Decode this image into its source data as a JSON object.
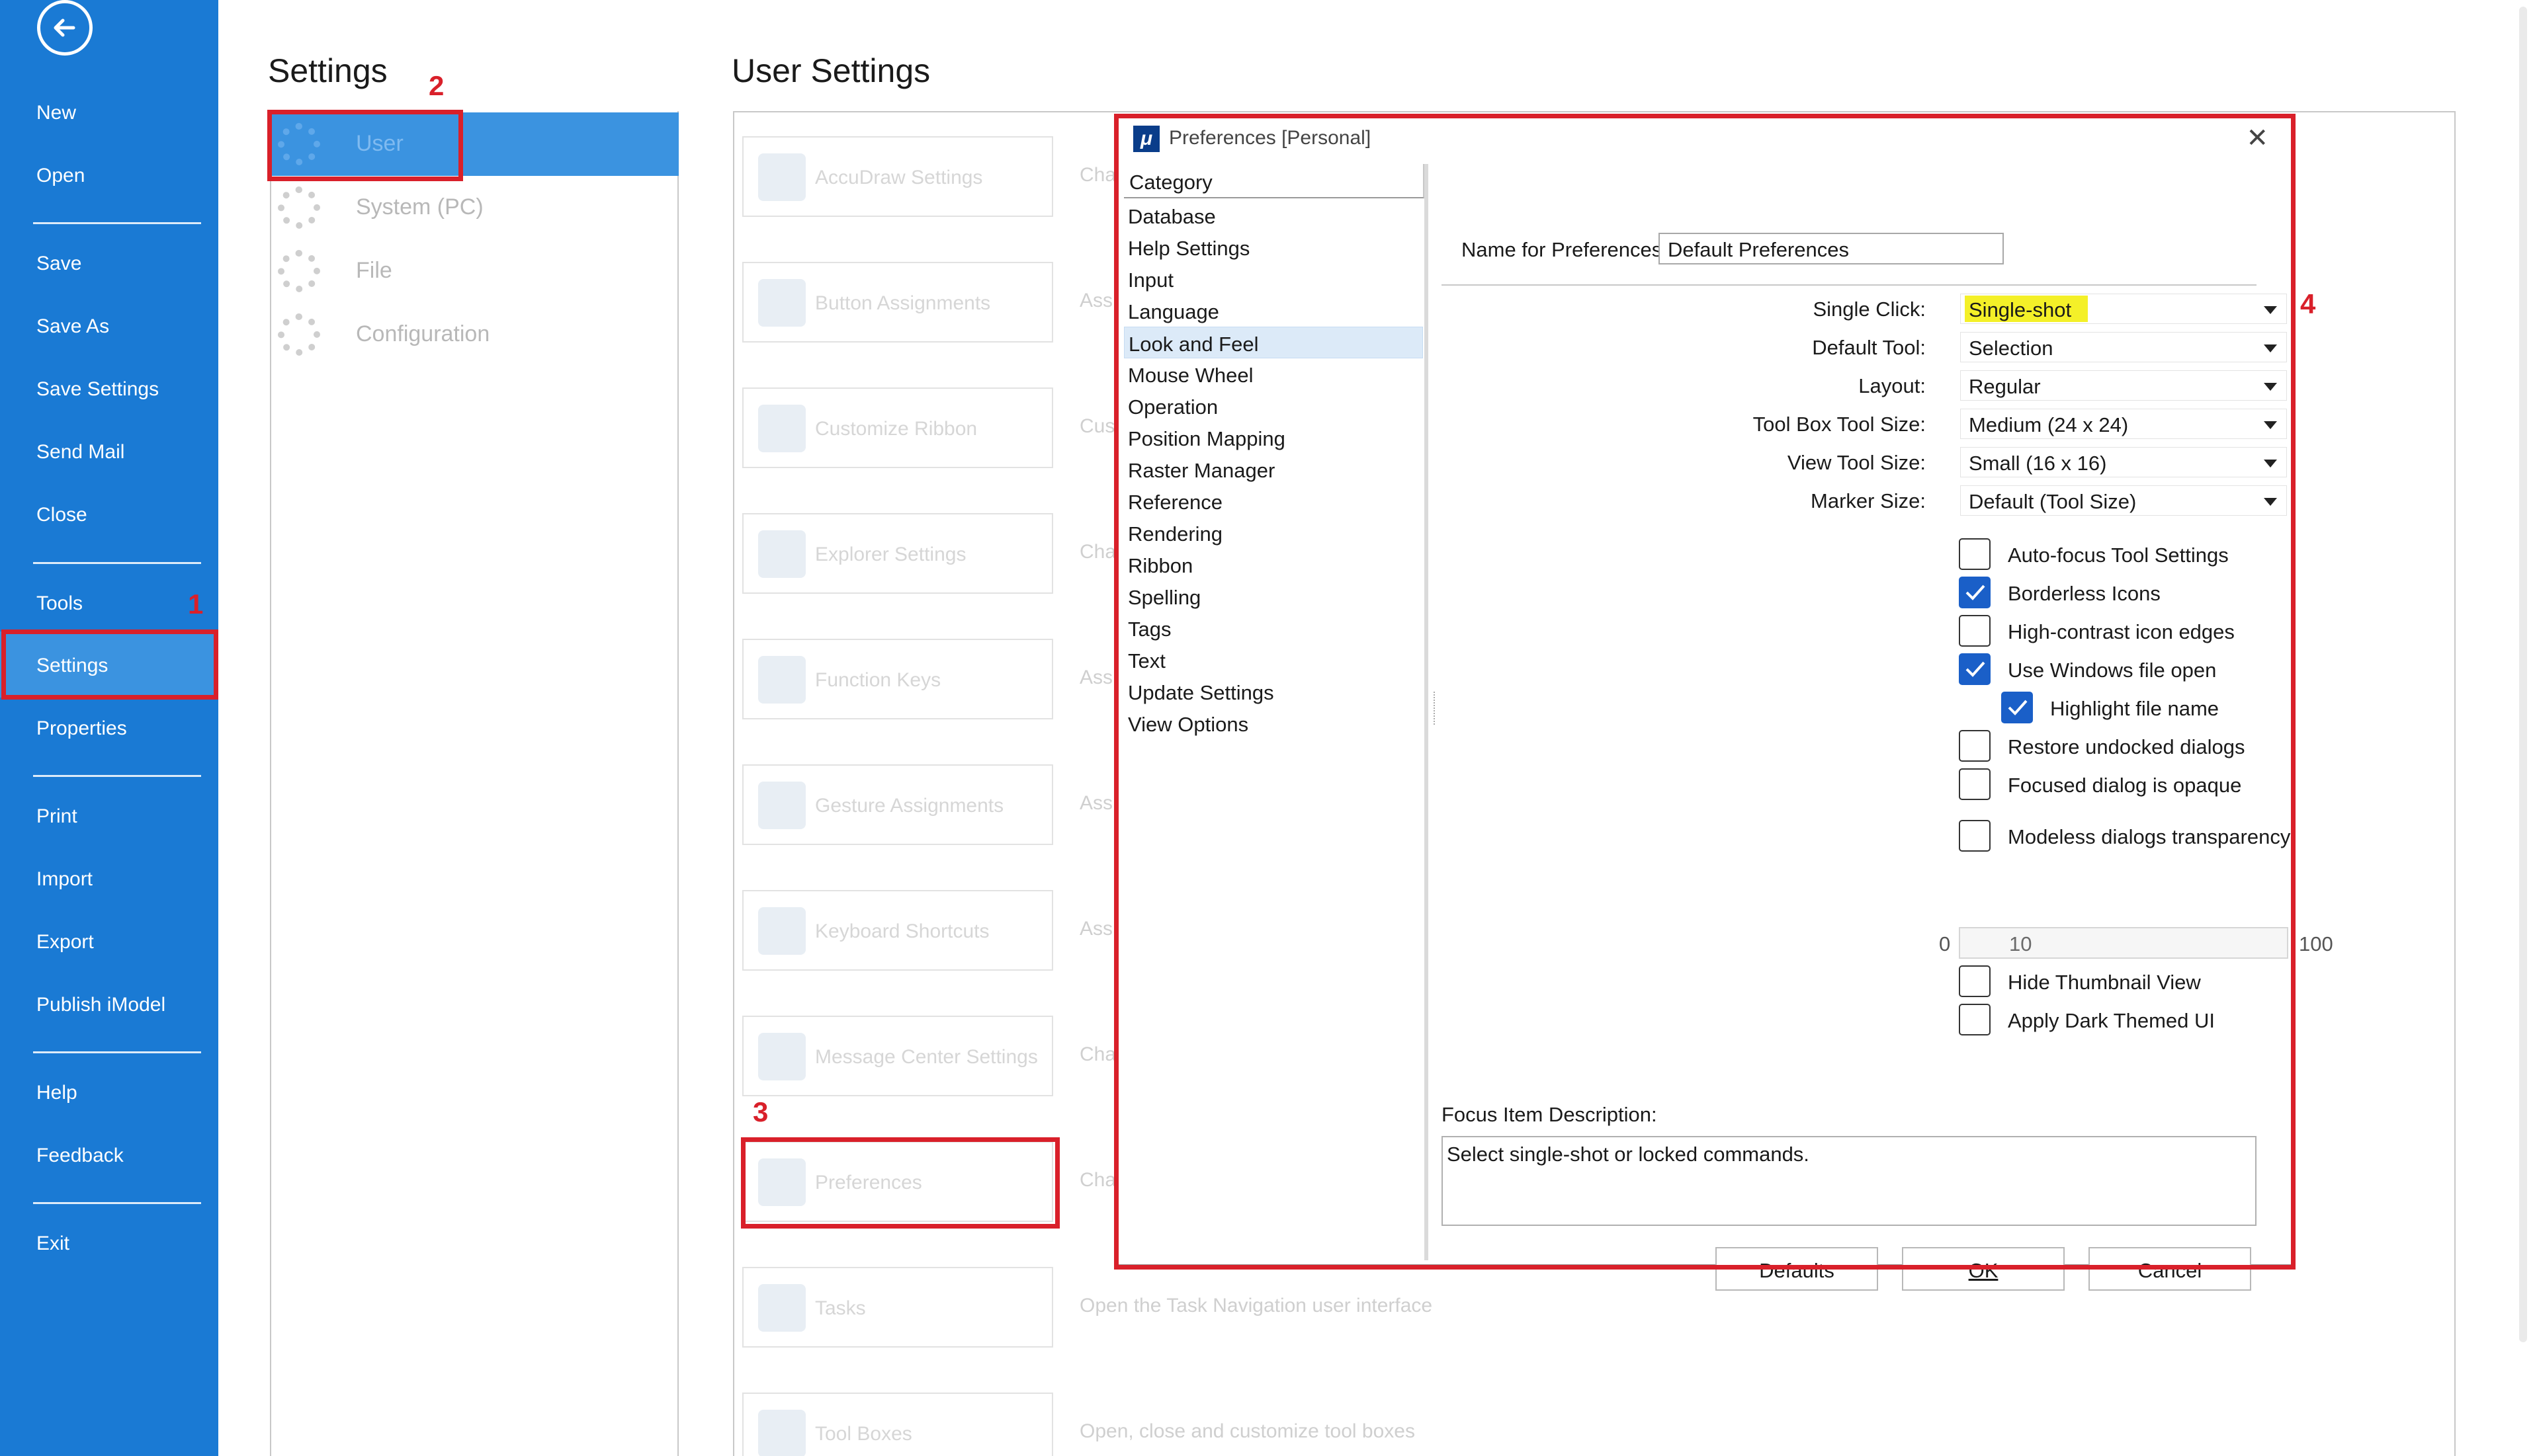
{
  "nav": {
    "items": [
      "New",
      "Open",
      "Save",
      "Save As",
      "Save Settings",
      "Send Mail",
      "Close",
      "Tools",
      "Settings",
      "Properties",
      "Print",
      "Import",
      "Export",
      "Publish iModel",
      "Help",
      "Feedback",
      "Exit"
    ],
    "active": "Settings"
  },
  "settings": {
    "title": "Settings",
    "items": [
      "User",
      "System (PC)",
      "File",
      "Configuration"
    ],
    "selected": "User"
  },
  "user_settings": {
    "title": "User Settings",
    "tiles": [
      {
        "label": "AccuDraw Settings",
        "desc": "Cha"
      },
      {
        "label": "Button Assignments",
        "desc": "Ass"
      },
      {
        "label": "Customize Ribbon",
        "desc": "Cus"
      },
      {
        "label": "Explorer Settings",
        "desc": "Cha"
      },
      {
        "label": "Function Keys",
        "desc": "Ass"
      },
      {
        "label": "Gesture Assignments",
        "desc": "Ass"
      },
      {
        "label": "Keyboard Shortcuts",
        "desc": "Ass"
      },
      {
        "label": "Message Center Settings",
        "desc": "Cha"
      },
      {
        "label": "Preferences",
        "desc": "Cha"
      },
      {
        "label": "Tasks",
        "desc": "Open the Task Navigation user interface"
      },
      {
        "label": "Tool Boxes",
        "desc": "Open, close and customize tool boxes"
      }
    ]
  },
  "annotations": [
    "1",
    "2",
    "3",
    "4"
  ],
  "dialog": {
    "title": "Preferences [Personal]",
    "close": "✕",
    "category_header": "Category",
    "categories": [
      "Database",
      "Help Settings",
      "Input",
      "Language",
      "Look and Feel",
      "Mouse Wheel",
      "Operation",
      "Position Mapping",
      "Raster Manager",
      "Reference",
      "Rendering",
      "Ribbon",
      "Spelling",
      "Tags",
      "Text",
      "Update Settings",
      "View Options"
    ],
    "selected_category": "Look and Feel",
    "name_label": "Name for Preferences:",
    "name_value": "Default Preferences",
    "fields": [
      {
        "label": "Single Click:",
        "value": "Single-shot"
      },
      {
        "label": "Default Tool:",
        "value": "Selection"
      },
      {
        "label": "Layout:",
        "value": "Regular"
      },
      {
        "label": "Tool Box Tool Size:",
        "value": "Medium (24 x 24)"
      },
      {
        "label": "View Tool Size:",
        "value": "Small (16 x 16)"
      },
      {
        "label": "Marker Size:",
        "value": "Default (Tool Size)"
      }
    ],
    "checkboxes": [
      {
        "label": "Auto-focus Tool Settings",
        "checked": false
      },
      {
        "label": "Borderless Icons",
        "checked": true
      },
      {
        "label": "High-contrast icon edges",
        "checked": false
      },
      {
        "label": "Use Windows file open",
        "checked": true
      },
      {
        "label": "Highlight file name",
        "checked": true
      },
      {
        "label": "Restore undocked dialogs",
        "checked": false
      },
      {
        "label": "Focused dialog is opaque",
        "checked": false
      },
      {
        "label": "Modeless dialogs transparency",
        "checked": false
      },
      {
        "label": "Hide Thumbnail View",
        "checked": false
      },
      {
        "label": "Apply Dark Themed UI",
        "checked": false
      }
    ],
    "transparency": {
      "min": "0",
      "value": "10",
      "max": "100"
    },
    "focus_label": "Focus Item Description:",
    "focus_text": "Select single-shot or locked commands.",
    "buttons": {
      "defaults": "Defaults",
      "ok": "OK",
      "cancel": "Cancel"
    }
  }
}
